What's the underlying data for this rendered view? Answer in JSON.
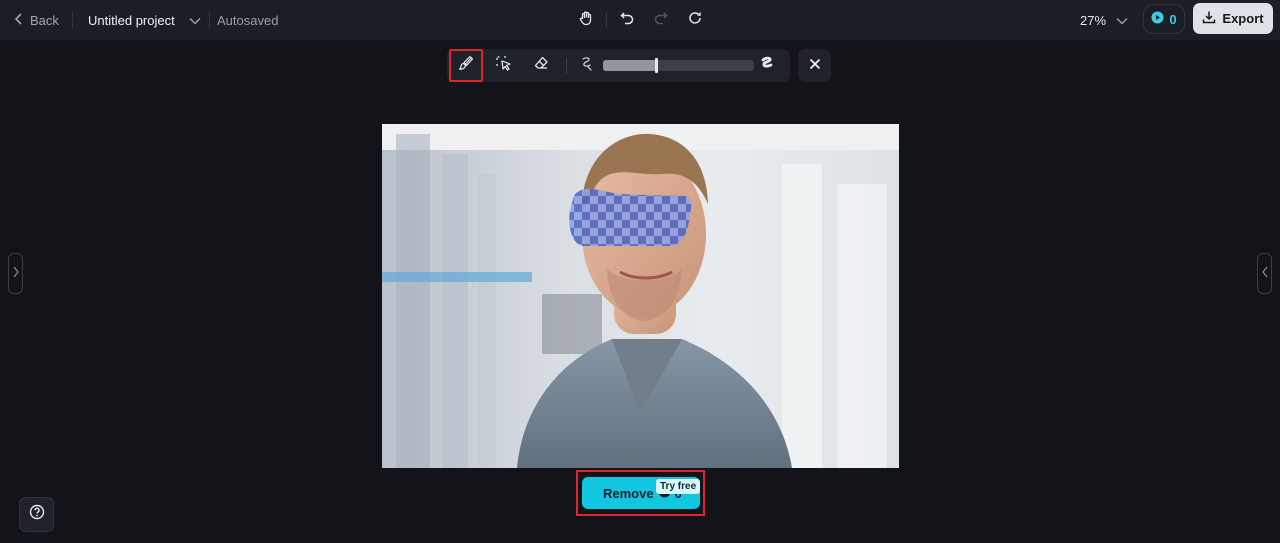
{
  "topbar": {
    "back_label": "Back",
    "project_title": "Untitled project",
    "save_status": "Autosaved",
    "zoom_level": "27%",
    "credits_count": "0",
    "export_label": "Export"
  },
  "toolbar": {
    "tools": [
      "brush-icon",
      "smart-select-icon",
      "eraser-icon"
    ],
    "active_tool": "brush",
    "brush_size_fraction": 0.35
  },
  "actions": {
    "remove_label": "Remove",
    "remove_cost": "0",
    "try_free_badge": "Try free"
  },
  "colors": {
    "accent": "#10c7df",
    "highlight": "#e0262c",
    "background": "#121419",
    "topbar": "#1b1e24"
  }
}
